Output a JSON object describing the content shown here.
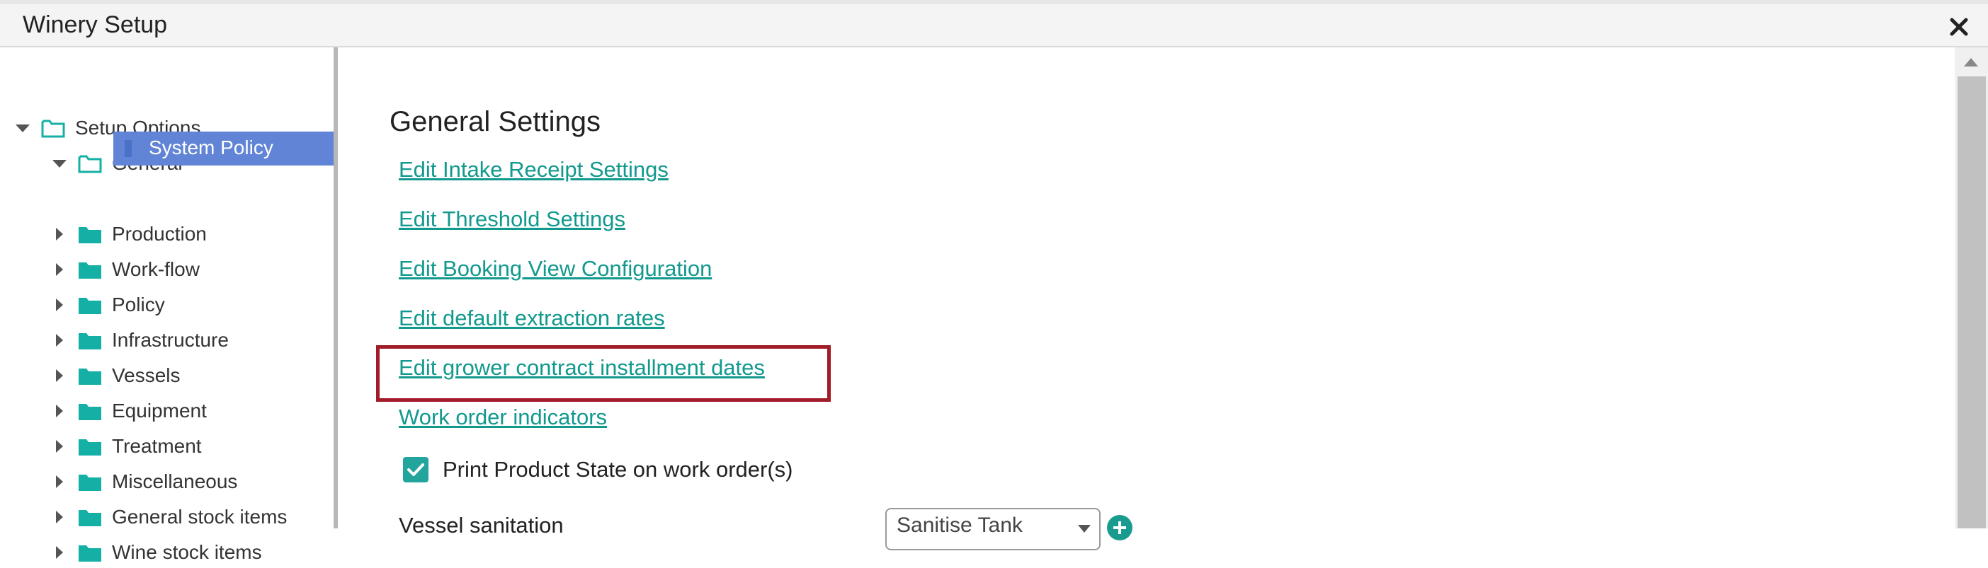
{
  "window": {
    "title": "Winery Setup"
  },
  "tree": {
    "root": "Setup Options",
    "general": "General",
    "selected": "System Policy",
    "items": [
      "Production",
      "Work-flow",
      "Policy",
      "Infrastructure",
      "Vessels",
      "Equipment",
      "Treatment",
      "Miscellaneous",
      "General stock items",
      "Wine stock items"
    ]
  },
  "main": {
    "section_title": "General Settings",
    "links": [
      "Edit Intake Receipt Settings",
      "Edit Threshold Settings",
      "Edit Booking View Configuration",
      "Edit default extraction rates",
      "Edit grower contract installment dates",
      "Work order indicators"
    ],
    "checkbox_label": "Print Product State on work order(s)",
    "vessel_label": "Vessel sanitation",
    "vessel_select_value": "Sanitise Tank"
  },
  "colors": {
    "accent": "#11998e",
    "selected_bg": "#6184d6",
    "highlight": "#a11c28",
    "folder": "#14b0a6"
  }
}
